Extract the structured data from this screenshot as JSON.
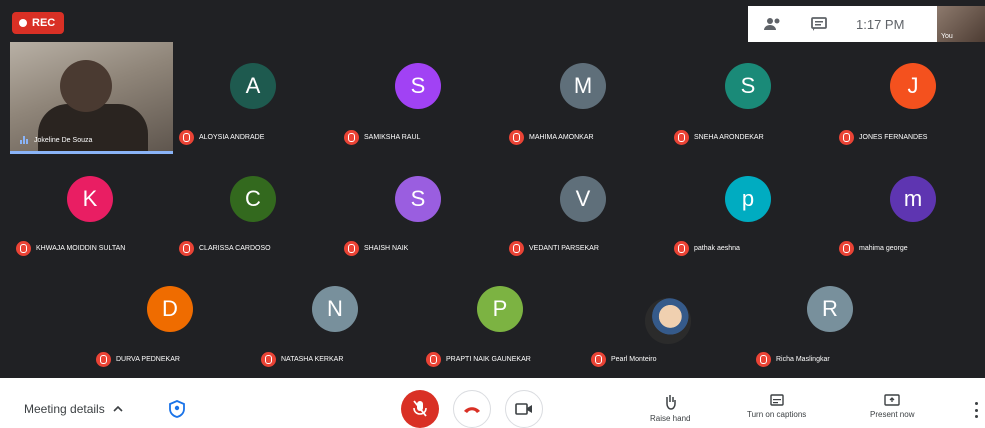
{
  "recording": {
    "label": "REC"
  },
  "header": {
    "time": "1:17 PM",
    "self_label": "You",
    "people_icon": "people-icon",
    "chat_icon": "chat-icon"
  },
  "speaker": {
    "name": "Jokeline De Souza",
    "icon": "speaking-indicator"
  },
  "participants": [
    {
      "initial": "A",
      "name": "ALOYSIA ANDRADE",
      "color": "#1e5a4f"
    },
    {
      "initial": "S",
      "name": "SAMIKSHA RAUL",
      "color": "#a142f4"
    },
    {
      "initial": "M",
      "name": "MAHIMA AMONKAR",
      "color": "#5f6f7a"
    },
    {
      "initial": "S",
      "name": "SNEHA ARONDEKAR",
      "color": "#1a8a78"
    },
    {
      "initial": "J",
      "name": "JONES FERNANDES",
      "color": "#f4511e"
    },
    {
      "initial": "K",
      "name": "KHWAJA MOIDDIN SULTAN",
      "color": "#e91e63"
    },
    {
      "initial": "C",
      "name": "CLARISSA CARDOSO",
      "color": "#33691e"
    },
    {
      "initial": "S",
      "name": "SHAISH NAIK",
      "color": "#9a5ee0"
    },
    {
      "initial": "V",
      "name": "VEDANTI PARSEKAR",
      "color": "#5f6f7a"
    },
    {
      "initial": "p",
      "name": "pathak aeshna",
      "color": "#00acc1"
    },
    {
      "initial": "m",
      "name": "mahima george",
      "color": "#5e35b1"
    },
    {
      "initial": "D",
      "name": "DURVA PEDNEKAR",
      "color": "#ef6c00"
    },
    {
      "initial": "N",
      "name": "NATASHA KERKAR",
      "color": "#78909c"
    },
    {
      "initial": "P",
      "name": "PRAPTI NAIK GAUNEKAR",
      "color": "#7cb342"
    },
    {
      "initial": "",
      "name": "Pearl Monteiro",
      "color": "#2b2b2b"
    },
    {
      "initial": "R",
      "name": "Richa Maslingkar",
      "color": "#78909c"
    }
  ],
  "bottom": {
    "meeting_details": "Meeting details",
    "raise_hand": "Raise hand",
    "captions": "Turn on captions",
    "present": "Present now"
  },
  "icons": {
    "mic": "mic-off-icon",
    "leave": "call-end-icon",
    "camera": "camera-icon",
    "hand": "hand-icon",
    "captions": "captions-icon",
    "present": "present-icon",
    "more": "more-vert-icon",
    "shield": "shield-icon"
  }
}
